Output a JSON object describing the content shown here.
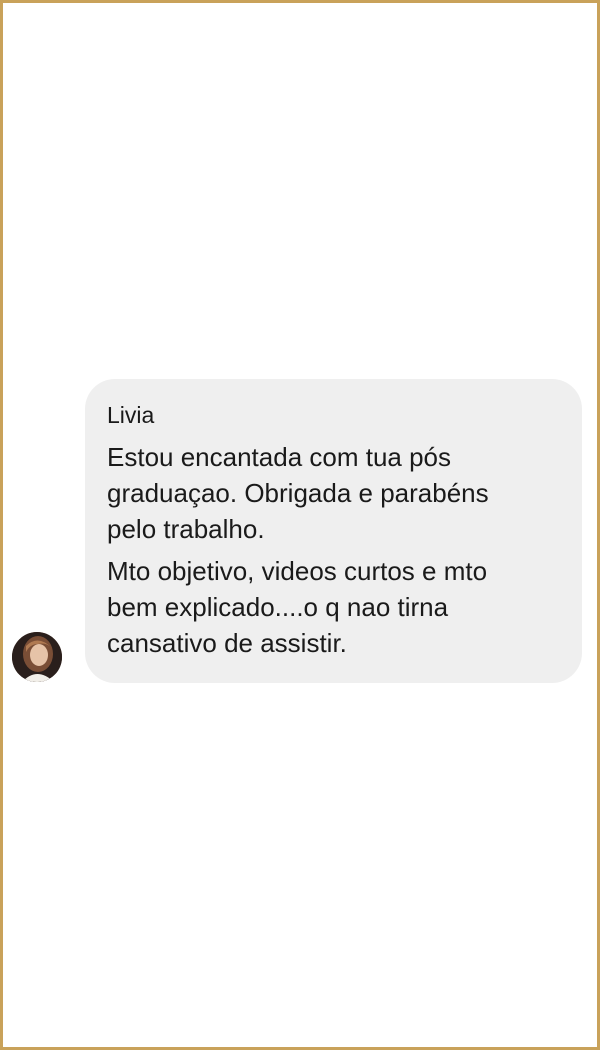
{
  "message": {
    "sender": "Livia",
    "paragraphs": [
      "Estou encantada com tua pós\ngraduaçao. Obrigada e parabéns\npelo trabalho.",
      "Mto objetivo, videos curtos e mto\nbem explicado....o q nao tirna\ncansativo de assistir."
    ]
  },
  "colors": {
    "frame_border": "#c9a25a",
    "bubble_background": "#efefef",
    "text": "#1a1a1a"
  },
  "icons": {
    "avatar": "user-avatar-photo"
  }
}
